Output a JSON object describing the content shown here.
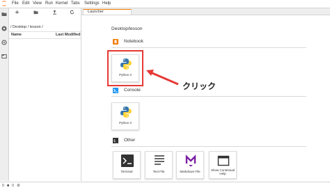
{
  "menubar": {
    "items": [
      "File",
      "Edit",
      "View",
      "Run",
      "Kernel",
      "Tabs",
      "Settings",
      "Help"
    ]
  },
  "filebrowser": {
    "breadcrumb": "/ Desktop / lesson /",
    "col_name": "Name",
    "col_modified": "Last Modified"
  },
  "tab": {
    "label": "Launcher"
  },
  "launcher": {
    "path": "Desktop/lesson",
    "sections": [
      {
        "title": "Notebook",
        "icon": "notebook-icon",
        "color": "#f57c00"
      },
      {
        "title": "Console",
        "icon": "console-icon",
        "color": "#2196f3"
      },
      {
        "title": "Other",
        "icon": "terminal-icon",
        "color": "#333333"
      }
    ],
    "notebook_card": "Python 3",
    "console_card": "Python 3",
    "other_cards": [
      "Terminal",
      "Text File",
      "Markdown File",
      "Show Contextual Help"
    ]
  },
  "annotation": {
    "text": "クリック",
    "color": "#e53935"
  },
  "statusbar": {
    "left": "0",
    "middle": "0"
  }
}
